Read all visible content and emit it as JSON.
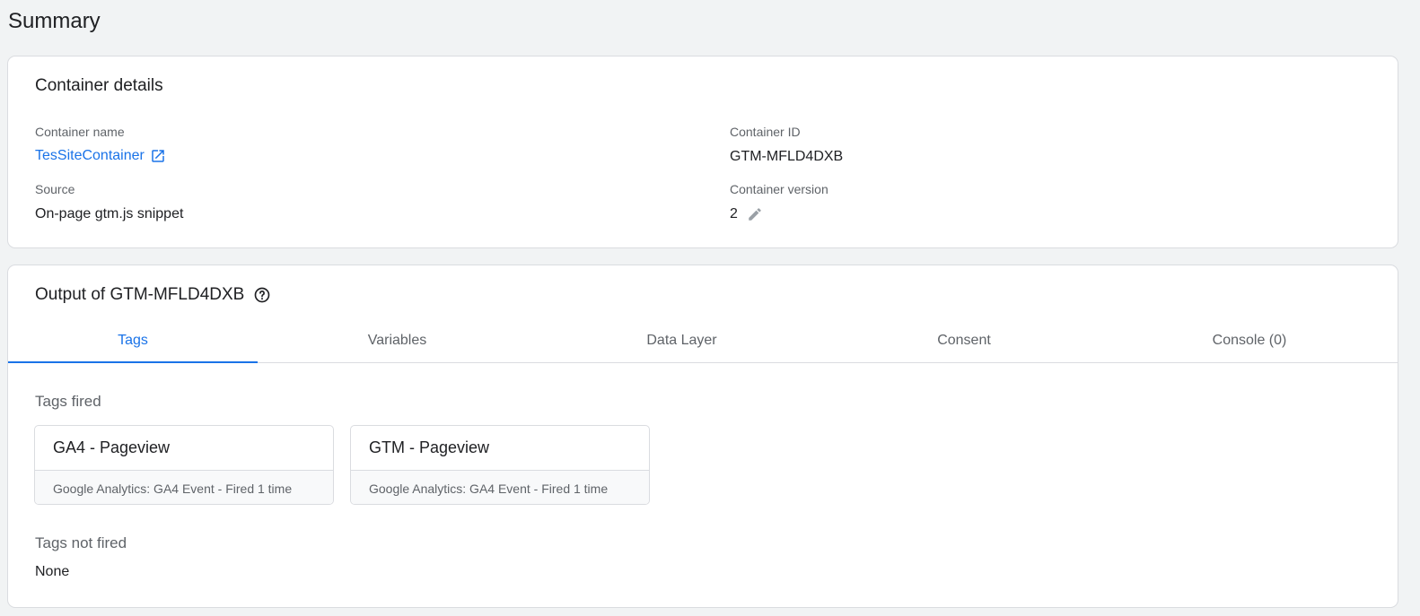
{
  "page": {
    "title": "Summary"
  },
  "details": {
    "heading": "Container details",
    "container_name_label": "Container name",
    "container_name_value": "TesSiteContainer",
    "container_id_label": "Container ID",
    "container_id_value": "GTM-MFLD4DXB",
    "source_label": "Source",
    "source_value": "On-page gtm.js snippet",
    "version_label": "Container version",
    "version_value": "2"
  },
  "output": {
    "heading": "Output of GTM-MFLD4DXB",
    "tabs": [
      {
        "label": "Tags",
        "active": true
      },
      {
        "label": "Variables",
        "active": false
      },
      {
        "label": "Data Layer",
        "active": false
      },
      {
        "label": "Consent",
        "active": false
      },
      {
        "label": "Console (0)",
        "active": false
      }
    ],
    "tags_fired_label": "Tags fired",
    "tags_fired": [
      {
        "name": "GA4 - Pageview",
        "meta": "Google Analytics: GA4 Event - Fired 1 time"
      },
      {
        "name": "GTM - Pageview",
        "meta": "Google Analytics: GA4 Event - Fired 1 time"
      }
    ],
    "tags_not_fired_label": "Tags not fired",
    "tags_not_fired_value": "None"
  },
  "icons": {
    "external_link": "external-link-icon",
    "edit": "pencil-icon",
    "help": "help-circle-icon"
  },
  "colors": {
    "accent": "#1a73e8",
    "background": "#f1f3f4",
    "border": "#dadce0",
    "muted_text": "#5f6368"
  }
}
